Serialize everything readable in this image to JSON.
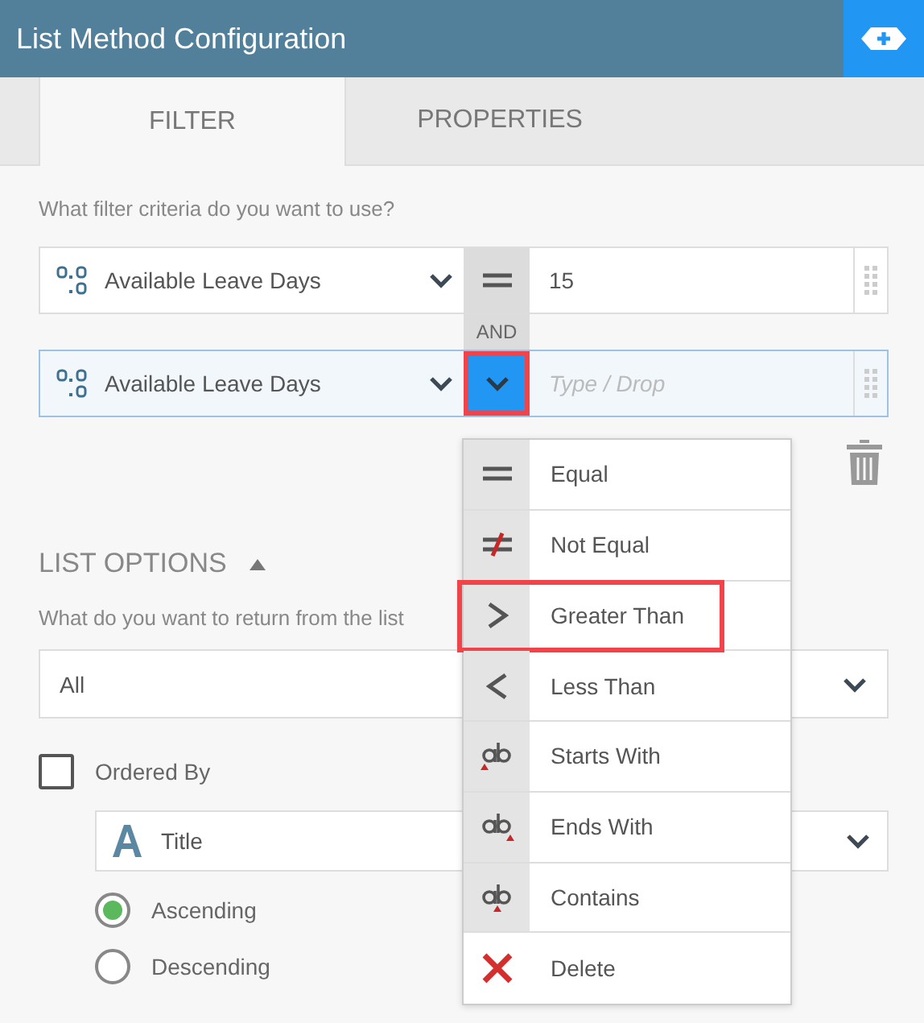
{
  "header": {
    "title": "List Method Configuration"
  },
  "tabs": [
    {
      "label": "FILTER",
      "selected": true
    },
    {
      "label": "PROPERTIES",
      "selected": false
    }
  ],
  "filter": {
    "prompt": "What filter criteria do you want to use?",
    "joiner": "AND",
    "conditions": [
      {
        "field": "Available Leave Days",
        "kind": "equal",
        "value": "15",
        "active": false,
        "highlighted": false
      },
      {
        "field": "Available Leave Days",
        "kind": "dropdown",
        "placeholder": "Type / Drop",
        "active": true,
        "highlighted": true
      }
    ]
  },
  "operator_menu": {
    "items": [
      {
        "kind": "equal",
        "label": "Equal",
        "highlighted": false
      },
      {
        "kind": "not_equal",
        "label": "Not Equal",
        "highlighted": false
      },
      {
        "kind": "greater",
        "label": "Greater Than",
        "highlighted": true
      },
      {
        "kind": "less",
        "label": "Less Than",
        "highlighted": false
      },
      {
        "kind": "starts",
        "label": "Starts With",
        "highlighted": false
      },
      {
        "kind": "ends",
        "label": "Ends With",
        "highlighted": false
      },
      {
        "kind": "contains",
        "label": "Contains",
        "highlighted": false
      },
      {
        "kind": "delete",
        "label": "Delete",
        "highlighted": false
      }
    ]
  },
  "list_options": {
    "heading": "LIST OPTIONS",
    "expanded": true,
    "prompt": "What do you want to return from the list",
    "return_value": "All",
    "ordered_by": {
      "label": "Ordered By",
      "checked": false
    },
    "order_field": "Title",
    "sort": [
      {
        "label": "Ascending",
        "selected": true
      },
      {
        "label": "Descending",
        "selected": false
      }
    ]
  }
}
